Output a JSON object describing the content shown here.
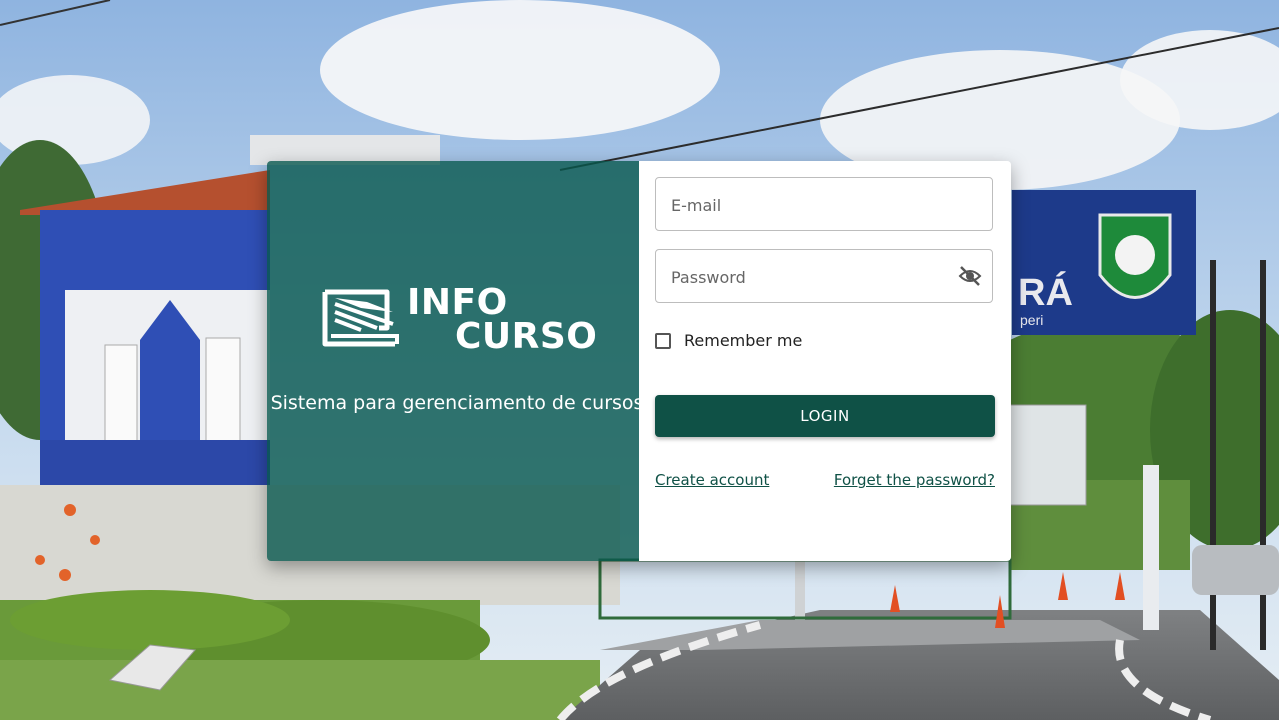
{
  "brand": {
    "logo_line1": "INFO",
    "logo_line2": "CURSO",
    "tagline": "Sistema para gerenciamento de cursos",
    "panel_color": "#08584e"
  },
  "form": {
    "email_placeholder": "E-mail",
    "password_placeholder": "Password",
    "remember_label": "Remember me",
    "remember_checked": false,
    "login_label": "LOGIN",
    "create_account": "Create account",
    "forget_password": "Forget the password?",
    "button_color": "#0f5146"
  },
  "background": {
    "sign_text_1": "RÁ",
    "sign_text_2": "peri"
  },
  "icons": {
    "logo": "open-laptop-logo-icon",
    "visibility": "eye-off-icon"
  }
}
